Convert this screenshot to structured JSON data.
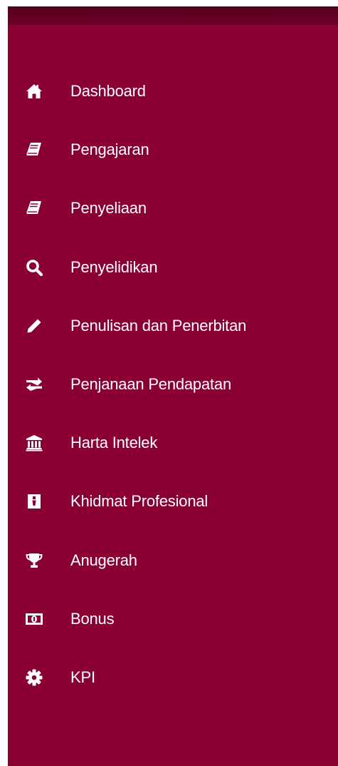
{
  "sidebar": {
    "background_color": "#8b0033",
    "topbar_color": "#5a0020",
    "items": [
      {
        "label": "Dashboard",
        "icon": "home-icon"
      },
      {
        "label": "Pengajaran",
        "icon": "book-icon"
      },
      {
        "label": "Penyeliaan",
        "icon": "book-icon"
      },
      {
        "label": "Penyelidikan",
        "icon": "search-icon"
      },
      {
        "label": "Penulisan dan Penerbitan",
        "icon": "pencil-icon"
      },
      {
        "label": "Penjanaan Pendapatan",
        "icon": "exchange-icon"
      },
      {
        "label": "Harta Intelek",
        "icon": "institution-icon"
      },
      {
        "label": "Khidmat Profesional",
        "icon": "id-badge-icon"
      },
      {
        "label": "Anugerah",
        "icon": "trophy-icon"
      },
      {
        "label": "Bonus",
        "icon": "money-icon"
      },
      {
        "label": "KPI",
        "icon": "gear-icon"
      }
    ]
  }
}
